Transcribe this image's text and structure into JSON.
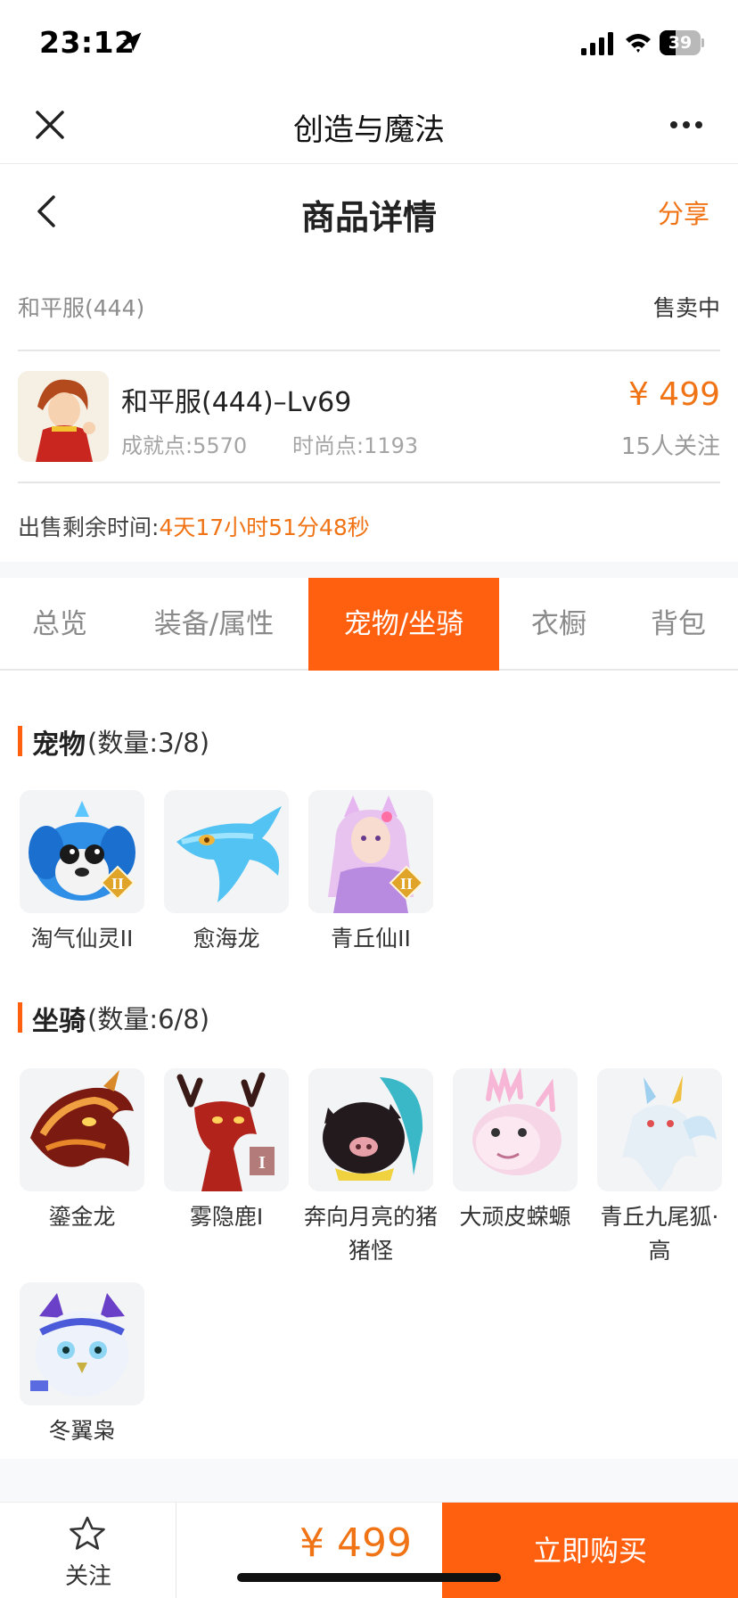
{
  "status_bar": {
    "time": "23:12",
    "battery": "39",
    "battery_level": 0.39
  },
  "app_header": {
    "title": "创造与魔法"
  },
  "page_header": {
    "title": "商品详情",
    "share": "分享"
  },
  "listing": {
    "server": "和平服(444)",
    "status": "售卖中",
    "title": "和平服(444)–Lv69",
    "achievement": "成就点:5570",
    "fashion": "时尚点:1193",
    "price": "¥ 499",
    "watchers": "15人关注",
    "time_label": "出售剩余时间:",
    "time_value": "4天17小时51分48秒"
  },
  "tabs": [
    {
      "label": "总览",
      "active": false
    },
    {
      "label": "装备/属性",
      "active": false
    },
    {
      "label": "宠物/坐骑",
      "active": true
    },
    {
      "label": "衣橱",
      "active": false
    },
    {
      "label": "背包",
      "active": false
    }
  ],
  "pets": {
    "title": "宠物",
    "count": "(数量:3/8)",
    "items": [
      {
        "label": "淘气仙灵II",
        "icon": "blue-puppy-pet",
        "badge": "II"
      },
      {
        "label": "愈海龙",
        "icon": "sea-dragon-pet",
        "badge": ""
      },
      {
        "label": "青丘仙II",
        "icon": "fox-fairy-pet",
        "badge": "II"
      }
    ]
  },
  "mounts": {
    "title": "坐骑",
    "count": "(数量:6/8)",
    "items": [
      {
        "label": "鎏金龙",
        "icon": "golden-dragon-mount",
        "badge": ""
      },
      {
        "label": "雾隐鹿I",
        "icon": "red-deer-mount",
        "badge": "I"
      },
      {
        "label": "奔向月亮的猪猪怪",
        "icon": "pig-monster-mount",
        "badge": ""
      },
      {
        "label": "大顽皮蝾螈",
        "icon": "axolotl-mount",
        "badge": ""
      },
      {
        "label": "青丘九尾狐·高",
        "icon": "nine-tail-fox-mount",
        "badge": ""
      },
      {
        "label": "冬翼枭",
        "icon": "winter-owl-mount",
        "badge": ""
      }
    ]
  },
  "bottom_bar": {
    "follow": "关注",
    "price": "¥ 499",
    "buy": "立即购买"
  },
  "colors": {
    "accent": "#ff6010",
    "price": "#f07416"
  }
}
